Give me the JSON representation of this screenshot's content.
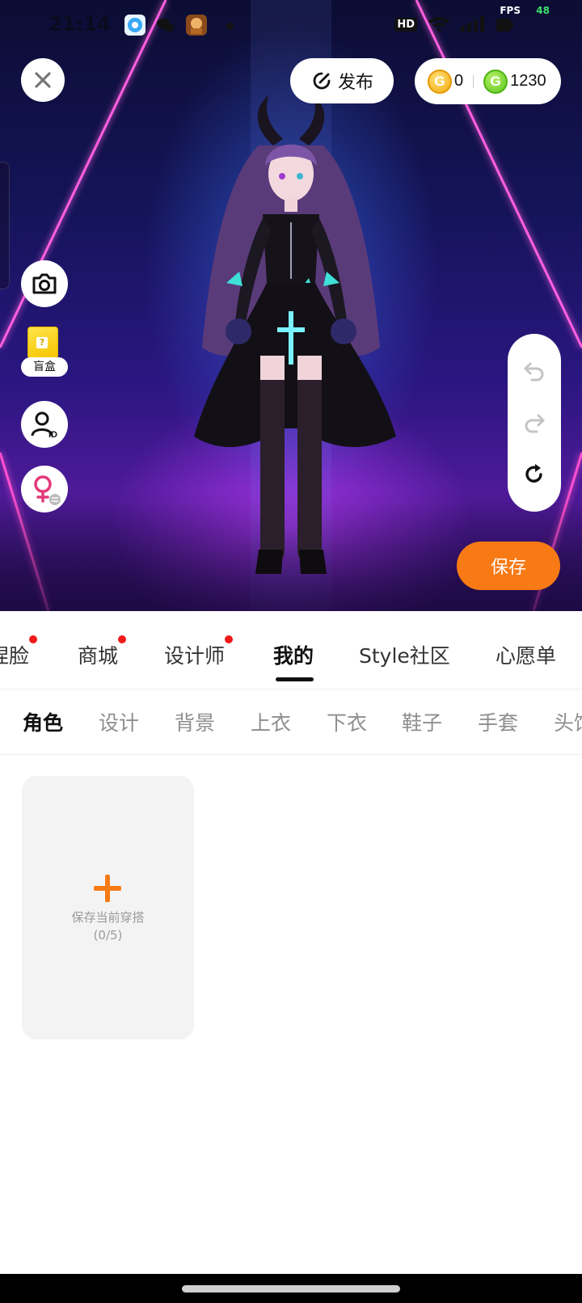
{
  "status_bar": {
    "time": "21:14",
    "fps_label": "FPS",
    "fps_value": "48",
    "hd_label": "HD",
    "app_icons": [
      "browser-app-icon",
      "wechat-app-icon",
      "game-app-icon"
    ]
  },
  "header": {
    "publish_label": "发布",
    "gold_coins": "0",
    "green_coins": "1230",
    "gold_coin_letter": "G",
    "green_coin_letter": "G"
  },
  "side_tools": {
    "blindbox_label": "盲盒",
    "blindbox_mark": "?",
    "id_badge": "ID"
  },
  "save_label": "保存",
  "main_tabs": [
    {
      "label": "捏脸",
      "dot": true
    },
    {
      "label": "商城",
      "dot": true
    },
    {
      "label": "设计师",
      "dot": true
    },
    {
      "label": "我的",
      "dot": false,
      "active": true
    },
    {
      "label": "Style社区",
      "dot": false
    },
    {
      "label": "心愿单",
      "dot": false
    }
  ],
  "sub_tabs": [
    {
      "label": "角色",
      "active": true
    },
    {
      "label": "设计"
    },
    {
      "label": "背景"
    },
    {
      "label": "上衣"
    },
    {
      "label": "下衣"
    },
    {
      "label": "鞋子"
    },
    {
      "label": "手套"
    },
    {
      "label": "头饰"
    }
  ],
  "outfit_slot": {
    "label": "保存当前穿搭",
    "count": "(0/5)"
  },
  "colors": {
    "accent": "#f77a15",
    "notification_dot": "#f01a1a",
    "gold_coin": "#f3a90f",
    "green_coin": "#5cc71a"
  }
}
